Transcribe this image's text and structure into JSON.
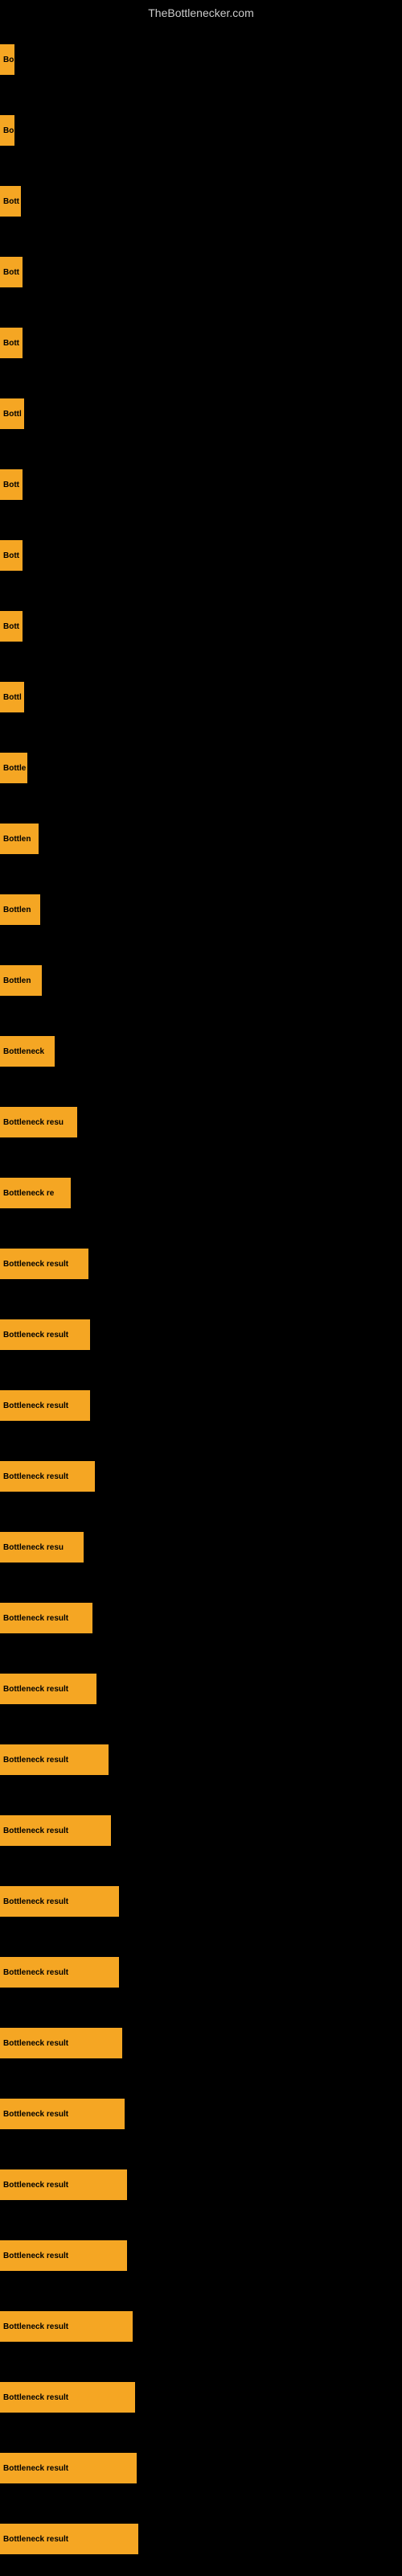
{
  "site_title": "TheBottlenecker.com",
  "bars": [
    {
      "label": "Bo",
      "width": 18
    },
    {
      "label": "Bo",
      "width": 18
    },
    {
      "label": "Bott",
      "width": 26
    },
    {
      "label": "Bott",
      "width": 28
    },
    {
      "label": "Bott",
      "width": 28
    },
    {
      "label": "Bottl",
      "width": 30
    },
    {
      "label": "Bott",
      "width": 28
    },
    {
      "label": "Bott",
      "width": 28
    },
    {
      "label": "Bott",
      "width": 28
    },
    {
      "label": "Bottl",
      "width": 30
    },
    {
      "label": "Bottle",
      "width": 34
    },
    {
      "label": "Bottlen",
      "width": 48
    },
    {
      "label": "Bottlen",
      "width": 50
    },
    {
      "label": "Bottlen",
      "width": 52
    },
    {
      "label": "Bottleneck",
      "width": 68
    },
    {
      "label": "Bottleneck resu",
      "width": 96
    },
    {
      "label": "Bottleneck re",
      "width": 88
    },
    {
      "label": "Bottleneck result",
      "width": 110
    },
    {
      "label": "Bottleneck result",
      "width": 112
    },
    {
      "label": "Bottleneck result",
      "width": 112
    },
    {
      "label": "Bottleneck result",
      "width": 118
    },
    {
      "label": "Bottleneck resu",
      "width": 104
    },
    {
      "label": "Bottleneck result",
      "width": 115
    },
    {
      "label": "Bottleneck result",
      "width": 120
    },
    {
      "label": "Bottleneck result",
      "width": 135
    },
    {
      "label": "Bottleneck result",
      "width": 138
    },
    {
      "label": "Bottleneck result",
      "width": 148
    },
    {
      "label": "Bottleneck result",
      "width": 148
    },
    {
      "label": "Bottleneck result",
      "width": 152
    },
    {
      "label": "Bottleneck result",
      "width": 155
    },
    {
      "label": "Bottleneck result",
      "width": 158
    },
    {
      "label": "Bottleneck result",
      "width": 158
    },
    {
      "label": "Bottleneck result",
      "width": 165
    },
    {
      "label": "Bottleneck result",
      "width": 168
    },
    {
      "label": "Bottleneck result",
      "width": 170
    },
    {
      "label": "Bottleneck result",
      "width": 172
    }
  ]
}
